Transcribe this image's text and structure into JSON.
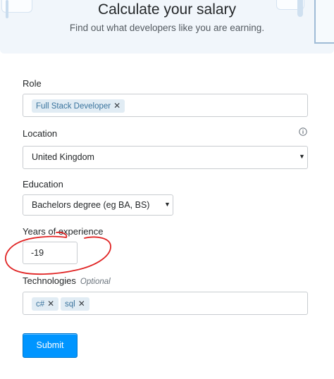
{
  "header": {
    "title": "Calculate your salary",
    "subtitle": "Find out what developers like you are earning."
  },
  "form": {
    "role": {
      "label": "Role",
      "tags": [
        "Full Stack Developer"
      ]
    },
    "location": {
      "label": "Location",
      "value": "United Kingdom"
    },
    "education": {
      "label": "Education",
      "value": "Bachelors degree (eg BA, BS)"
    },
    "experience": {
      "label": "Years of experience",
      "value": "-19"
    },
    "technologies": {
      "label": "Technologies",
      "optional": "Optional",
      "tags": [
        "c#",
        "sql"
      ]
    },
    "submit_label": "Submit"
  },
  "icons": {
    "remove": "close-icon",
    "dropdown": "caret-down-icon",
    "info": "info-icon"
  },
  "colors": {
    "accent": "#0095ff",
    "tag_bg": "#e1ecf4",
    "tag_text": "#39739d",
    "annotation": "#e02424"
  }
}
